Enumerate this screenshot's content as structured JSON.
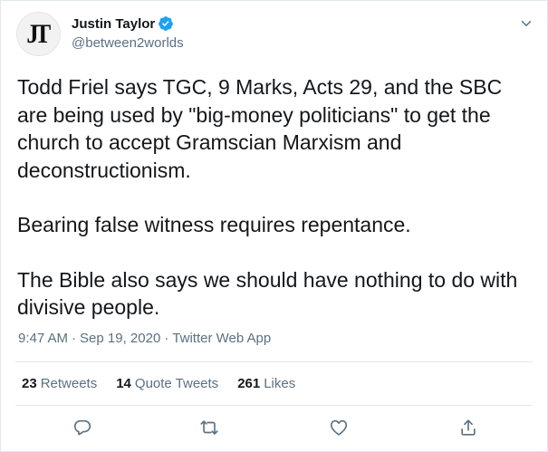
{
  "author": {
    "display_name": "Justin Taylor",
    "handle": "@between2worlds",
    "avatar_initials": "JT",
    "verified": true
  },
  "tweet": {
    "paragraphs": [
      "Todd Friel says TGC, 9 Marks, Acts 29, and the SBC are being used by \"big-money politicians\" to get the church to accept Gramscian Marxism and deconstructionism.",
      "Bearing false witness requires repentance.",
      "The Bible also says we should have nothing to do with divisive people."
    ],
    "time": "9:47 AM",
    "date": "Sep 19, 2020",
    "separator": "·",
    "source": "Twitter Web App"
  },
  "stats": {
    "retweets_count": "23",
    "retweets_label": "Retweets",
    "quotes_count": "14",
    "quotes_label": "Quote Tweets",
    "likes_count": "261",
    "likes_label": "Likes"
  },
  "icons": {
    "verified": "verified-badge-icon",
    "more": "chevron-down-icon",
    "reply": "reply-icon",
    "retweet": "retweet-icon",
    "like": "heart-icon",
    "share": "share-icon"
  },
  "colors": {
    "accent": "#1da1f2",
    "secondary_text": "#5b7083",
    "primary_text": "#14171a",
    "divider": "#e1e8ed"
  }
}
